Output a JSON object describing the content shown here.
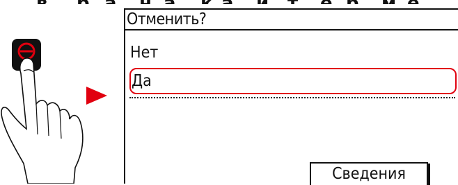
{
  "screen": {
    "title": "Отменить?",
    "options": [
      {
        "label": "Нет"
      },
      {
        "label": "Да"
      }
    ],
    "details_button": "Сведения"
  },
  "colors": {
    "accent": "#e1000f",
    "text": "#111111",
    "background": "#ffffff"
  },
  "icons": {
    "stop_button": "stop-icon",
    "pointer_arrow": "right-triangle-arrow"
  }
}
